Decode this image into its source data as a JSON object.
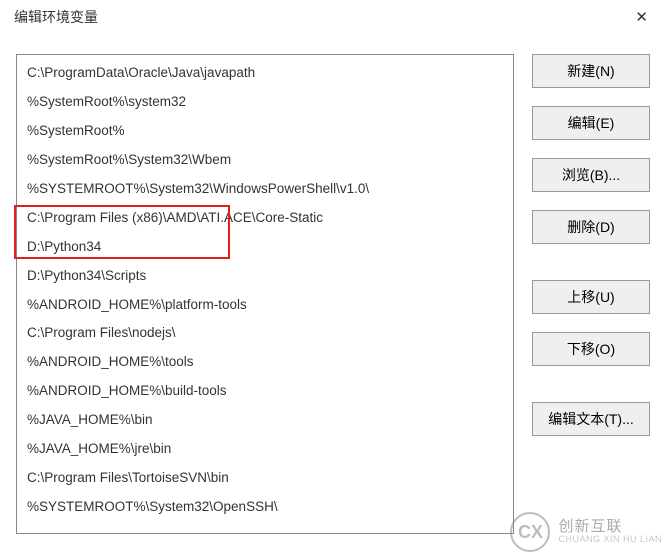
{
  "window": {
    "title": "编辑环境变量"
  },
  "list": {
    "items": [
      "C:\\ProgramData\\Oracle\\Java\\javapath",
      "%SystemRoot%\\system32",
      "%SystemRoot%",
      "%SystemRoot%\\System32\\Wbem",
      "%SYSTEMROOT%\\System32\\WindowsPowerShell\\v1.0\\",
      "C:\\Program Files (x86)\\AMD\\ATI.ACE\\Core-Static",
      "D:\\Python34",
      "D:\\Python34\\Scripts",
      "%ANDROID_HOME%\\platform-tools",
      "C:\\Program Files\\nodejs\\",
      "%ANDROID_HOME%\\tools",
      "%ANDROID_HOME%\\build-tools",
      "%JAVA_HOME%\\bin",
      "%JAVA_HOME%\\jre\\bin",
      "C:\\Program Files\\TortoiseSVN\\bin",
      "%SYSTEMROOT%\\System32\\OpenSSH\\"
    ]
  },
  "buttons": {
    "new": "新建(N)",
    "edit": "编辑(E)",
    "browse": "浏览(B)...",
    "delete": "删除(D)",
    "moveup": "上移(U)",
    "movedown": "下移(O)",
    "edittext": "编辑文本(T)..."
  },
  "watermark": {
    "brand_cn": "创新互联",
    "brand_py": "CHUANG XIN HU LIAN"
  }
}
